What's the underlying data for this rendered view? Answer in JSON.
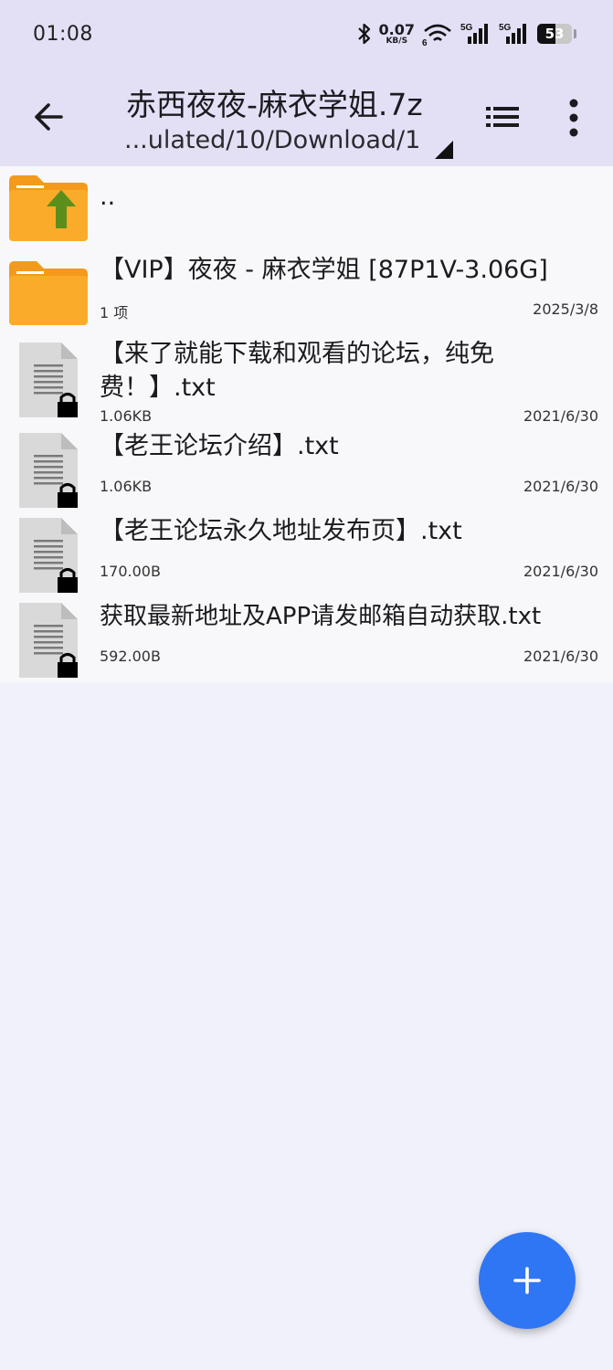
{
  "status_bar": {
    "time": "01:08",
    "net_speed_value": "0.07",
    "net_speed_unit": "KB/S",
    "wifi_label": "6",
    "signal1_label": "5G",
    "signal2_label": "5G",
    "battery": "53"
  },
  "toolbar": {
    "title": "赤西夜夜-麻衣学姐.7z",
    "path": "...ulated/10/Download/1"
  },
  "files": [
    {
      "name": "..",
      "type": "parent-folder"
    },
    {
      "name": "【VIP】夜夜 - 麻衣学姐 [87P1V-3.06G]",
      "type": "folder",
      "meta": "1 项",
      "date": "2025/3/8"
    },
    {
      "name_line1": "【来了就能下载和观看的论坛，纯免",
      "name_line2": "费！】.txt",
      "type": "locked-file",
      "meta": "1.06KB",
      "date": "2021/6/30"
    },
    {
      "name": "【老王论坛介绍】.txt",
      "type": "locked-file",
      "meta": "1.06KB",
      "date": "2021/6/30"
    },
    {
      "name": "【老王论坛永久地址发布页】.txt",
      "type": "locked-file",
      "meta": "170.00B",
      "date": "2021/6/30"
    },
    {
      "name": "获取最新地址及APP请发邮箱自动获取.txt",
      "type": "locked-file",
      "meta": "592.00B",
      "date": "2021/6/30"
    }
  ],
  "icons": {
    "back": "arrow-left-icon",
    "list_view": "list-view-icon",
    "more": "more-vertical-icon",
    "fab": "plus-icon",
    "folder_color": "#fbab2a",
    "up_arrow_color": "#5c8e1c",
    "accent": "#2f76f4",
    "header_bg": "#e3e0f6"
  }
}
